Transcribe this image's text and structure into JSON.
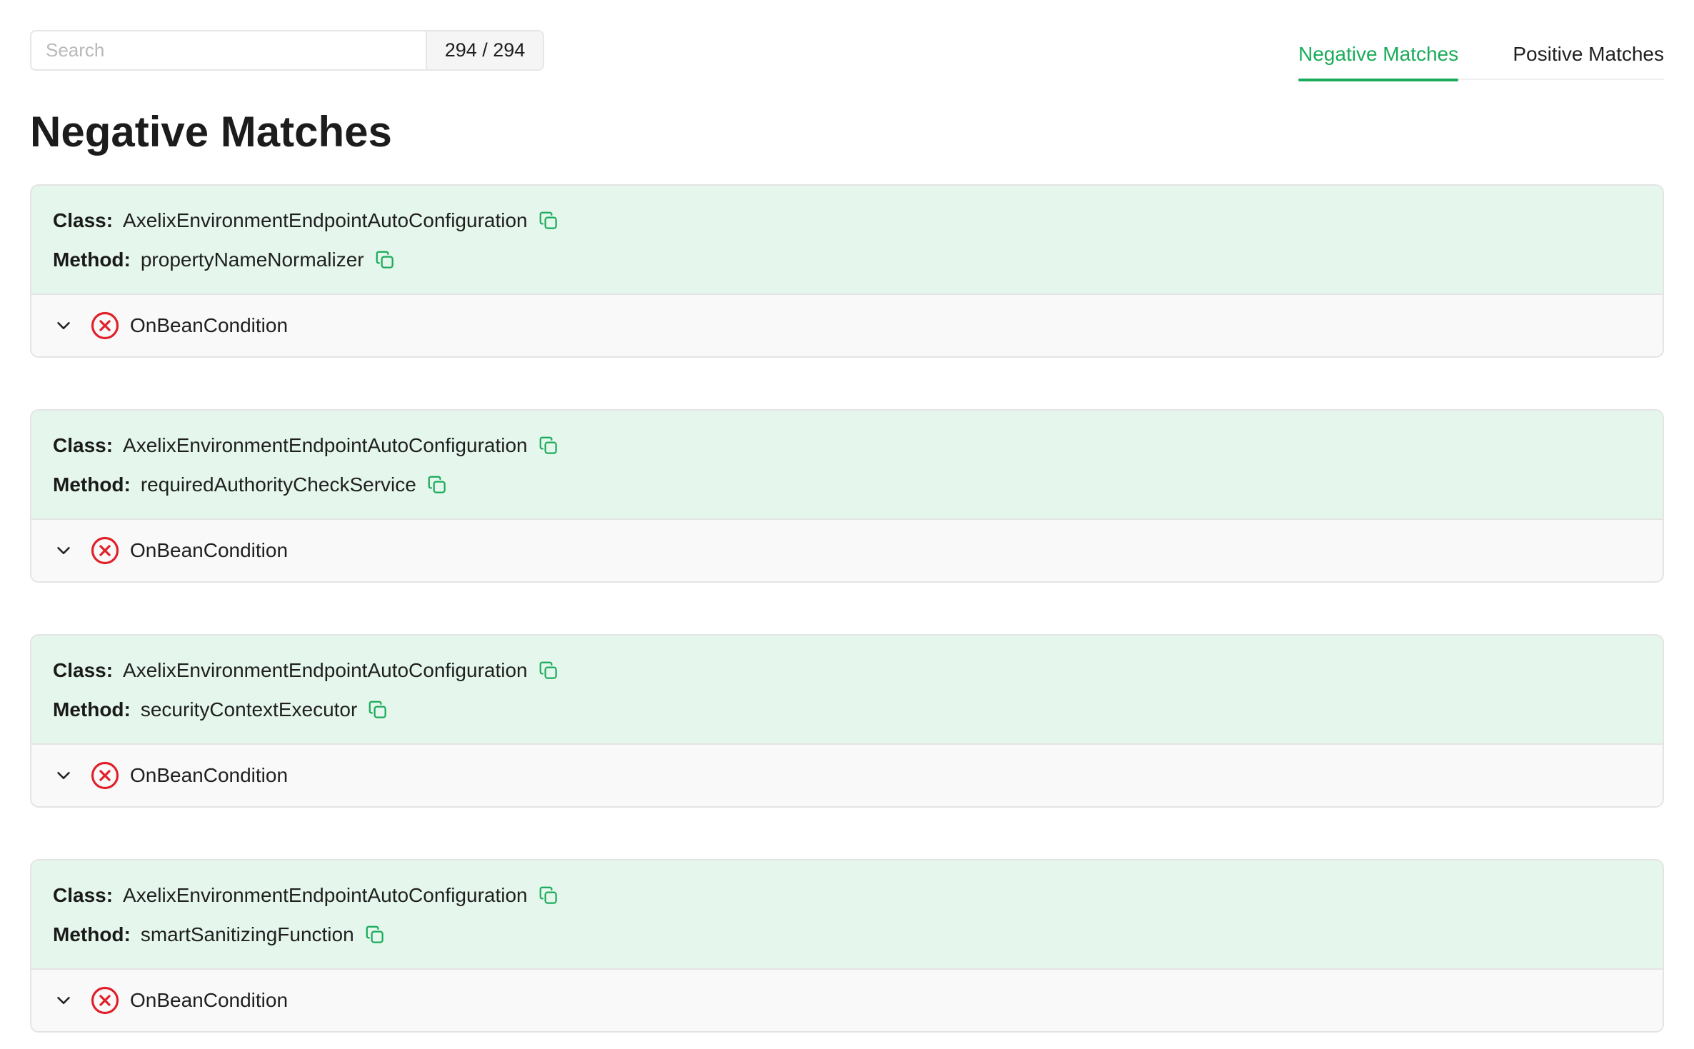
{
  "search": {
    "placeholder": "Search",
    "count": "294 / 294"
  },
  "tabs": [
    {
      "label": "Negative Matches",
      "active": true
    },
    {
      "label": "Positive Matches",
      "active": false
    }
  ],
  "page_title": "Negative Matches",
  "labels": {
    "class": "Class:",
    "method": "Method:"
  },
  "colors": {
    "accent": "#1aab5a",
    "card_header_bg": "#e5f7ec",
    "error": "#e0202a"
  },
  "icons": {
    "copy": "copy-icon",
    "chevron": "chevron-down-icon",
    "fail": "x-circle-icon"
  },
  "matches": [
    {
      "class": "AxelixEnvironmentEndpointAutoConfiguration",
      "method": "propertyNameNormalizer",
      "condition": "OnBeanCondition"
    },
    {
      "class": "AxelixEnvironmentEndpointAutoConfiguration",
      "method": "requiredAuthorityCheckService",
      "condition": "OnBeanCondition"
    },
    {
      "class": "AxelixEnvironmentEndpointAutoConfiguration",
      "method": "securityContextExecutor",
      "condition": "OnBeanCondition"
    },
    {
      "class": "AxelixEnvironmentEndpointAutoConfiguration",
      "method": "smartSanitizingFunction",
      "condition": "OnBeanCondition"
    }
  ]
}
